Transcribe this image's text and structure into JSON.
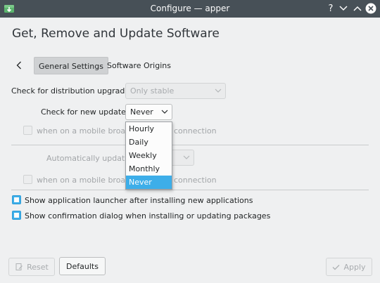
{
  "window": {
    "title": "Configure — apper",
    "help_glyph": "?",
    "accent_color": "#3daee9",
    "titlebar_color": "#475057"
  },
  "page": {
    "heading": "Get, Remove and Update Software"
  },
  "tabs": [
    {
      "label": "General Settings",
      "active": true
    },
    {
      "label": "Software Origins",
      "active": false
    }
  ],
  "form": {
    "distribution_upgrades": {
      "label": "Check for distribution upgrades:",
      "value": "Only stable",
      "enabled": false
    },
    "new_updates": {
      "label": "Check for new updates:",
      "value": "Never",
      "enabled": true
    },
    "mobile_check_1": {
      "label_left": "when on a mobile broadba",
      "label_right": "connection",
      "checked": false,
      "enabled": false
    },
    "auto_update": {
      "label": "Automatically update:",
      "enabled": false
    },
    "mobile_check_2": {
      "label_left": "when on a mobile broadba",
      "label_right": "connection",
      "checked": false,
      "enabled": false
    },
    "show_launcher": {
      "label": "Show application launcher after installing new applications",
      "checked": true
    },
    "show_confirmation": {
      "label": "Show confirmation dialog when installing or updating packages",
      "checked": true
    }
  },
  "dropdown": {
    "options": [
      "Hourly",
      "Daily",
      "Weekly",
      "Monthly",
      "Never"
    ],
    "selected": "Never"
  },
  "buttons": {
    "reset": "Reset",
    "defaults": "Defaults",
    "apply": "Apply"
  }
}
